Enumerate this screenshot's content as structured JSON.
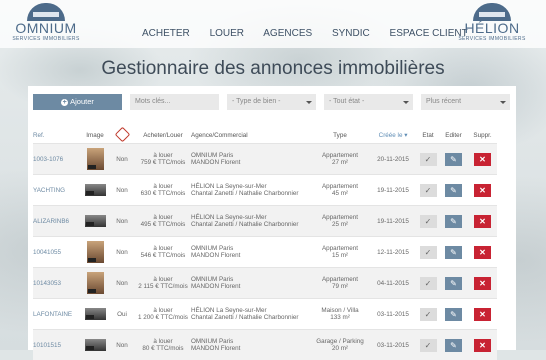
{
  "header": {
    "left_logo": {
      "name": "OMNIUM",
      "sub": "SERVICES IMMOBILIERS"
    },
    "right_logo": {
      "name": "HÉLION",
      "sub": "SERVICES IMMOBILIERS"
    },
    "nav": [
      "ACHETER",
      "LOUER",
      "AGENCES",
      "SYNDIC",
      "ESPACE CLIENT"
    ]
  },
  "title": "Gestionnaire des annonces immobilières",
  "filters": {
    "add_label": "Ajouter",
    "search_placeholder": "Mots clés...",
    "type_select": "- Type de bien -",
    "state_select": "- Tout état -",
    "sort_select": "Plus récent"
  },
  "columns": {
    "ref": "Ref.",
    "image": "Image",
    "buy_rent": "Acheter/Louer",
    "agency": "Agence/Commercial",
    "type": "Type",
    "created": "Créée le ▾",
    "state": "Etat",
    "edit": "Editer",
    "delete": "Suppr."
  },
  "rows": [
    {
      "ref": "1003-1076",
      "flag": "Non",
      "mode": "à louer",
      "price": "759 € TTC/mois",
      "agency": "OMNIUM Paris",
      "agent": "MANDON Florent",
      "type": "Appartement",
      "area": "27 m²",
      "date": "20-11-2015",
      "img": "tall"
    },
    {
      "ref": "YACHTING",
      "flag": "Non",
      "mode": "à louer",
      "price": "630 € TTC/mois",
      "agency": "HÉLION La Seyne-sur-Mer",
      "agent": "Chantal Zanetti / Nathalie Charbonnier",
      "type": "Appartement",
      "area": "45 m²",
      "date": "19-11-2015",
      "img": "wide"
    },
    {
      "ref": "ALIZARINB6",
      "flag": "Non",
      "mode": "à louer",
      "price": "495 € TTC/mois",
      "agency": "HÉLION La Seyne-sur-Mer",
      "agent": "Chantal Zanetti / Nathalie Charbonnier",
      "type": "Appartement",
      "area": "25 m²",
      "date": "19-11-2015",
      "img": "wide"
    },
    {
      "ref": "10041055",
      "flag": "Non",
      "mode": "à louer",
      "price": "546 € TTC/mois",
      "agency": "OMNIUM Paris",
      "agent": "MANDON Florent",
      "type": "Appartement",
      "area": "15 m²",
      "date": "12-11-2015",
      "img": "tall"
    },
    {
      "ref": "10143053",
      "flag": "Non",
      "mode": "à louer",
      "price": "2 115 € TTC/mois",
      "agency": "OMNIUM Paris",
      "agent": "MANDON Florent",
      "type": "Appartement",
      "area": "79 m²",
      "date": "04-11-2015",
      "img": "tall"
    },
    {
      "ref": "LAFONTAINE",
      "flag": "Oui",
      "mode": "à louer",
      "price": "1 200 € TTC/mois",
      "agency": "HÉLION La Seyne-sur-Mer",
      "agent": "Chantal Zanetti / Nathalie Charbonnier",
      "type": "Maison / Villa",
      "area": "133 m²",
      "date": "03-11-2015",
      "img": "wide"
    },
    {
      "ref": "10101515",
      "flag": "Non",
      "mode": "à louer",
      "price": "80 € TTC/mois",
      "agency": "OMNIUM Paris",
      "agent": "MANDON Florent",
      "type": "Garage / Parking",
      "area": "20 m²",
      "date": "03-11-2015",
      "img": "wide"
    }
  ],
  "icons": {
    "state": "check-icon",
    "edit": "edit-icon",
    "delete": "close-icon",
    "home": "home-icon"
  }
}
